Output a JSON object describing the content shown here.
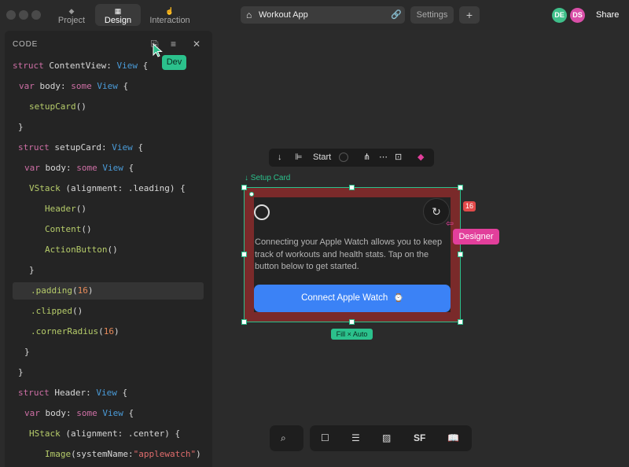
{
  "tabs": [
    {
      "label": "Project",
      "icon": "cube-icon"
    },
    {
      "label": "Design",
      "icon": "layout-icon",
      "active": true
    },
    {
      "label": "Interaction",
      "icon": "cursor-icon"
    }
  ],
  "address": {
    "title": "Workout App",
    "icon": "home-icon"
  },
  "header": {
    "settings_label": "Settings",
    "add_label": "+",
    "share_label": "Share"
  },
  "avatars": [
    {
      "initials": "DE",
      "color": "#3fbf8a"
    },
    {
      "initials": "DS",
      "color": "#d94fa8"
    }
  ],
  "code_panel": {
    "title": "CODE",
    "tooltip": "Dev",
    "lines": [
      {
        "text": "struct ContentView: View {"
      },
      {
        "text": "var body: some View {"
      },
      {
        "text": "setupCard()"
      },
      {
        "text": "}"
      },
      {
        "text": "struct setupCard: View {"
      },
      {
        "text": "var body: some View {"
      },
      {
        "text": "VStack (alignment: .leading) {"
      },
      {
        "text": "Header()"
      },
      {
        "text": "Content()"
      },
      {
        "text": "ActionButton()"
      },
      {
        "text": "}"
      },
      {
        "text": ".padding(16)"
      },
      {
        "text": ".clipped()"
      },
      {
        "text": ".cornerRadius(16)"
      },
      {
        "text": "}"
      },
      {
        "text": "}"
      },
      {
        "text": "struct Header: View {"
      },
      {
        "text": "var body: some View {"
      },
      {
        "text": "HStack (alignment: .center) {"
      },
      {
        "text": "Image(systemName:\"applewatch\")"
      }
    ]
  },
  "element_toolbar": {
    "align_label": "Start"
  },
  "frame": {
    "label": "Setup Card",
    "size_badge": "Fill × Auto",
    "padding_badge": "16"
  },
  "card": {
    "description": "Connecting your Apple Watch allows you to keep track of workouts and health stats. Tap on the button below to get started.",
    "button_label": "Connect Apple Watch"
  },
  "cursor_tag": "Designer",
  "bottom_toolbar": {
    "sf_label": "SF"
  },
  "colors": {
    "accent_green": "#2bc18c",
    "button_blue": "#3b82f6",
    "designer_pink": "#e23f9b",
    "padding_red": "#7a2a2a"
  }
}
